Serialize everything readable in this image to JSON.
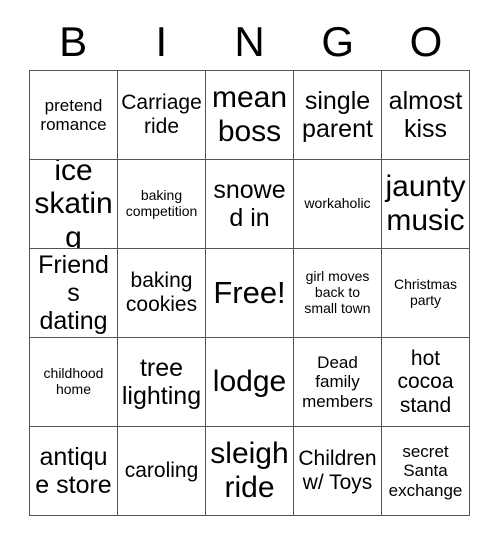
{
  "card": {
    "title": "BINGO",
    "headers": [
      "B",
      "I",
      "N",
      "G",
      "O"
    ],
    "free_space_label": "Free!",
    "colors": {
      "background": "#ffffff",
      "text": "#000000",
      "border": "#555555"
    },
    "rows": [
      [
        {
          "text": "pretend romance",
          "size": "s-sm"
        },
        {
          "text": "Carriage ride",
          "size": "s-md"
        },
        {
          "text": "mean boss",
          "size": "s-xl"
        },
        {
          "text": "single parent",
          "size": "s-lg"
        },
        {
          "text": "almost kiss",
          "size": "s-lg"
        }
      ],
      [
        {
          "text": "ice skating",
          "size": "s-xl"
        },
        {
          "text": "baking competition",
          "size": "s-xs"
        },
        {
          "text": "snowed in",
          "size": "s-lg"
        },
        {
          "text": "workaholic",
          "size": "s-xs"
        },
        {
          "text": "jaunty music",
          "size": "s-xl"
        }
      ],
      [
        {
          "text": "Friends dating",
          "size": "s-lg"
        },
        {
          "text": "baking cookies",
          "size": "s-md"
        },
        {
          "text": "Free!",
          "size": "s-free"
        },
        {
          "text": "girl moves back to small town",
          "size": "s-xs"
        },
        {
          "text": "Christmas party",
          "size": "s-xs"
        }
      ],
      [
        {
          "text": "childhood home",
          "size": "s-xs"
        },
        {
          "text": "tree lighting",
          "size": "s-lg"
        },
        {
          "text": "lodge",
          "size": "s-xl"
        },
        {
          "text": "Dead family members",
          "size": "s-sm"
        },
        {
          "text": "hot cocoa stand",
          "size": "s-md"
        }
      ],
      [
        {
          "text": "antique store",
          "size": "s-lg"
        },
        {
          "text": "caroling",
          "size": "s-md"
        },
        {
          "text": "sleigh ride",
          "size": "s-xl"
        },
        {
          "text": "Children w/ Toys",
          "size": "s-md"
        },
        {
          "text": "secret Santa exchange",
          "size": "s-sm"
        }
      ]
    ]
  }
}
